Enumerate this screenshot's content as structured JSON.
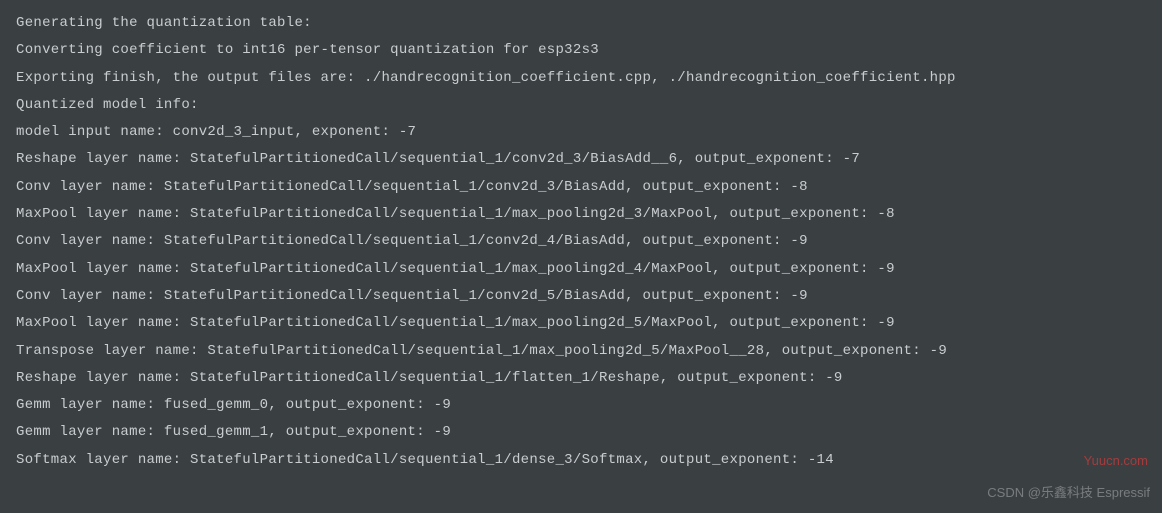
{
  "terminal": {
    "lines": [
      "Generating the quantization table:",
      "Converting coefficient to int16 per-tensor quantization for esp32s3",
      "Exporting finish, the output files are: ./handrecognition_coefficient.cpp, ./handrecognition_coefficient.hpp",
      "",
      "Quantized model info:",
      "model input name: conv2d_3_input, exponent: -7",
      "Reshape layer name: StatefulPartitionedCall/sequential_1/conv2d_3/BiasAdd__6, output_exponent: -7",
      "Conv layer name: StatefulPartitionedCall/sequential_1/conv2d_3/BiasAdd, output_exponent: -8",
      "MaxPool layer name: StatefulPartitionedCall/sequential_1/max_pooling2d_3/MaxPool, output_exponent: -8",
      "Conv layer name: StatefulPartitionedCall/sequential_1/conv2d_4/BiasAdd, output_exponent: -9",
      "MaxPool layer name: StatefulPartitionedCall/sequential_1/max_pooling2d_4/MaxPool, output_exponent: -9",
      "Conv layer name: StatefulPartitionedCall/sequential_1/conv2d_5/BiasAdd, output_exponent: -9",
      "MaxPool layer name: StatefulPartitionedCall/sequential_1/max_pooling2d_5/MaxPool, output_exponent: -9",
      "Transpose layer name: StatefulPartitionedCall/sequential_1/max_pooling2d_5/MaxPool__28, output_exponent: -9",
      "Reshape layer name: StatefulPartitionedCall/sequential_1/flatten_1/Reshape, output_exponent: -9",
      "Gemm layer name: fused_gemm_0, output_exponent: -9",
      "Gemm layer name: fused_gemm_1, output_exponent: -9",
      "Softmax layer name: StatefulPartitionedCall/sequential_1/dense_3/Softmax, output_exponent: -14"
    ]
  },
  "watermark": {
    "top": "Yuucn.com",
    "bottom": "CSDN @乐鑫科技 Espressif"
  }
}
